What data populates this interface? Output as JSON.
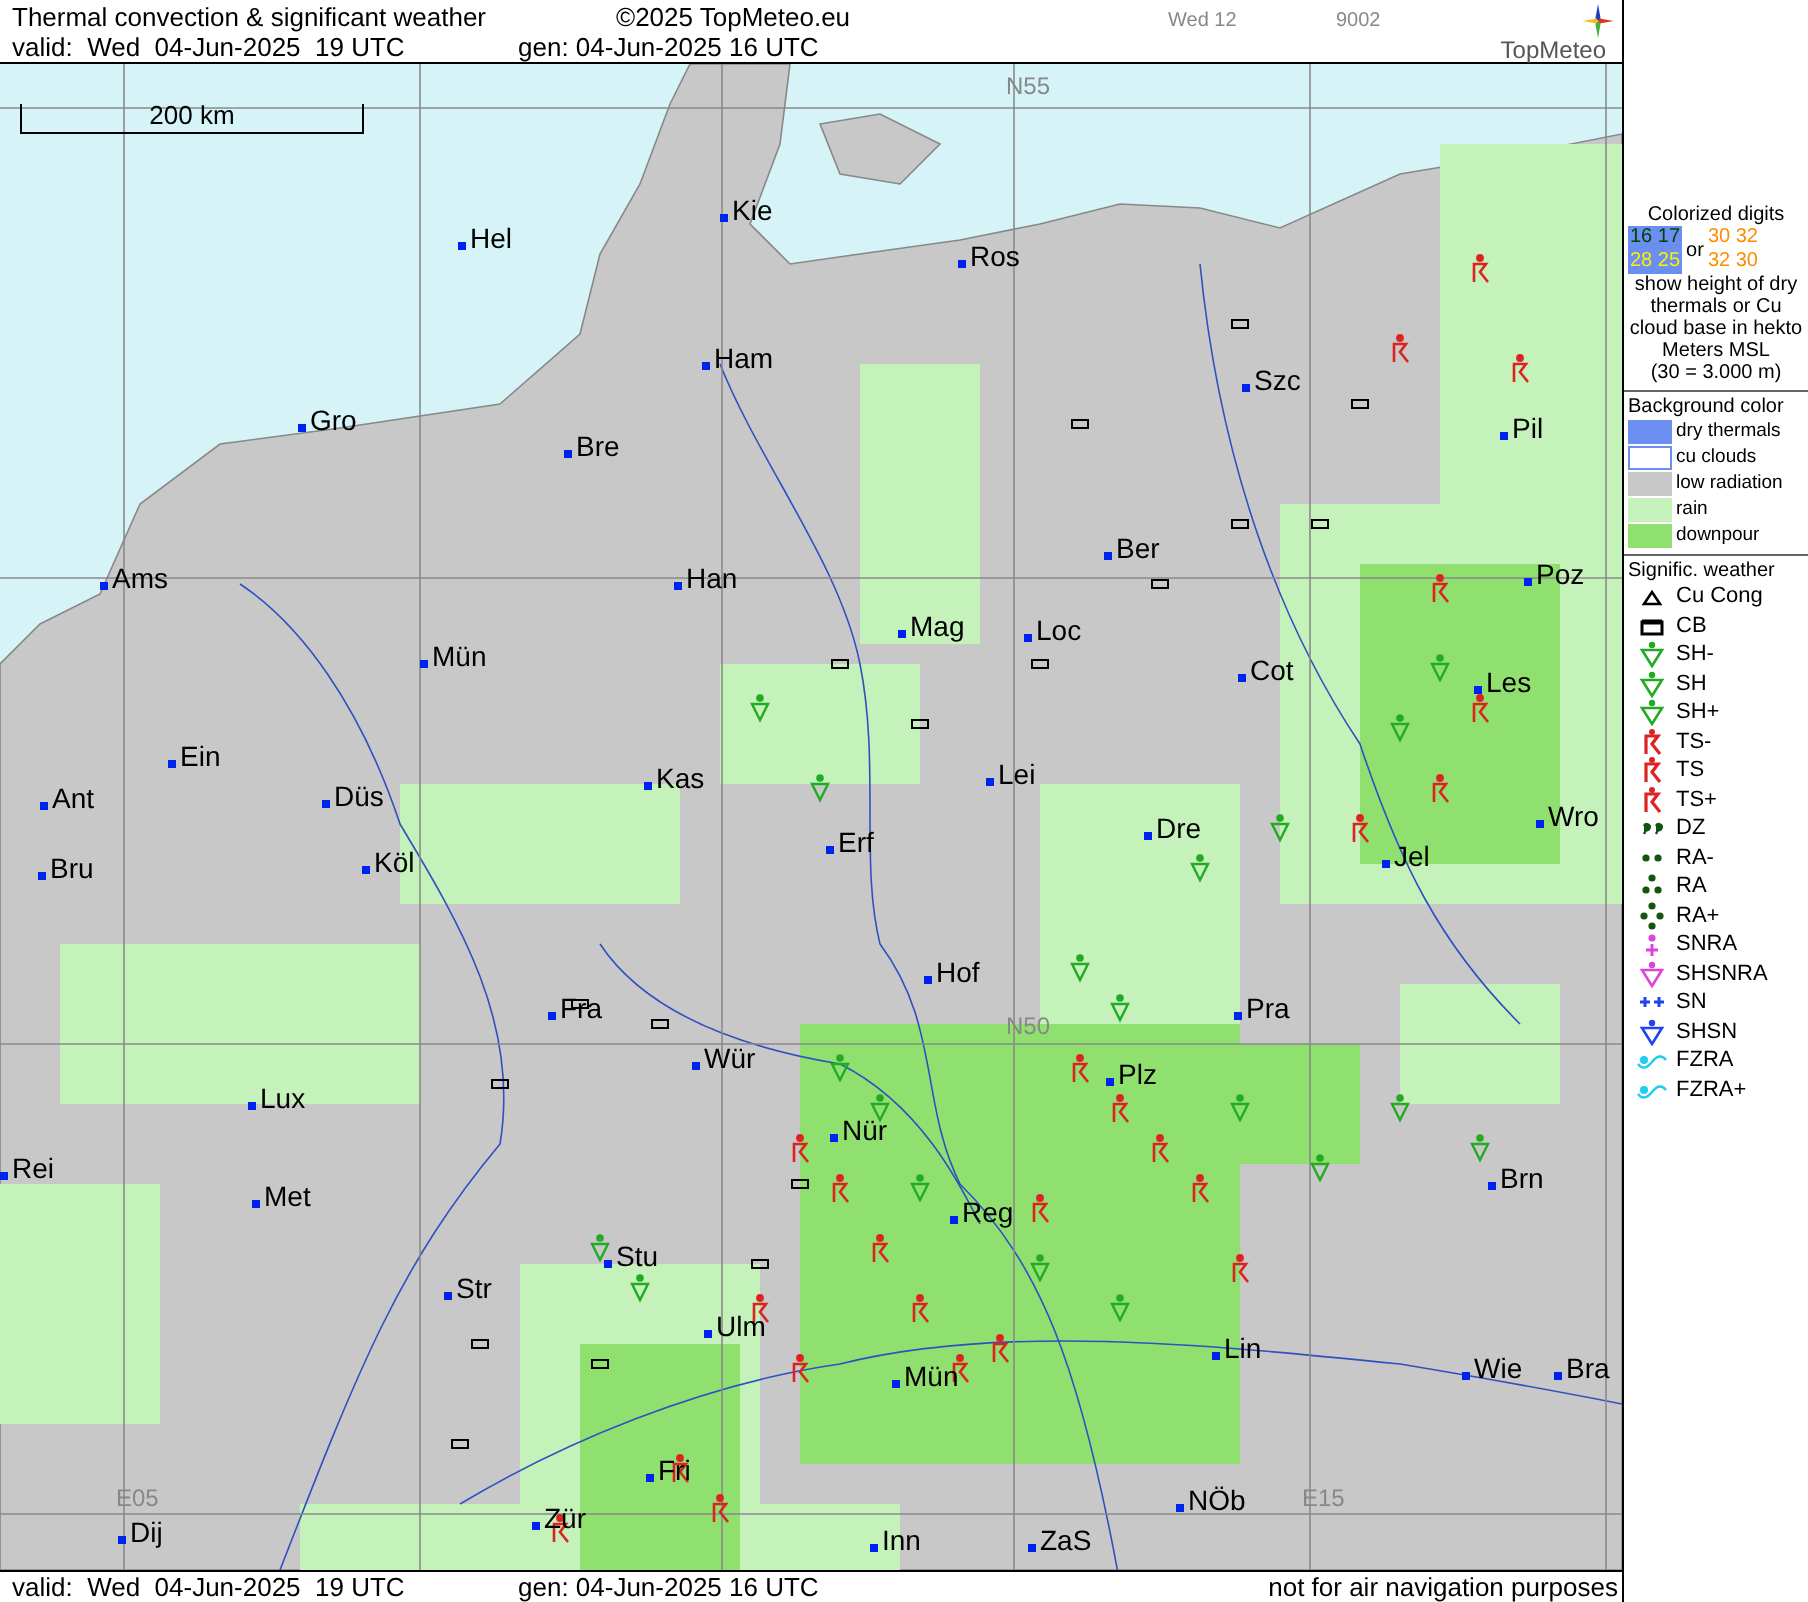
{
  "header": {
    "title": "Thermal convection & significant weather",
    "copyright": "©2025 TopMeteo.eu",
    "day": "Wed 12",
    "code": "9002",
    "logo": "TopMeteo",
    "valid": "valid:  Wed  04-Jun-2025  19 UTC",
    "gen": "gen: 04-Jun-2025 16 UTC"
  },
  "map": {
    "scale": "200 km",
    "grid_labels": [
      "N55",
      "N50",
      "E05",
      "E15"
    ],
    "cities": [
      "Hel",
      "Kie",
      "Ros",
      "Ham",
      "Gro",
      "Bre",
      "Szc",
      "Pil",
      "Ams",
      "Han",
      "Ber",
      "Poz",
      "Mag",
      "Loc",
      "Mün",
      "Cot",
      "Les",
      "Ein",
      "Kas",
      "Lei",
      "Ant",
      "Düs",
      "Dre",
      "Wro",
      "Bru",
      "Köl",
      "Erf",
      "Jel",
      "Hof",
      "Fra",
      "Pra",
      "Wür",
      "Plz",
      "Lux",
      "Nür",
      "Rei",
      "Met",
      "Brn",
      "Reg",
      "Stu",
      "Str",
      "Ulm",
      "Lin",
      "Mün",
      "Wie",
      "Bra",
      "Fri",
      "Dij",
      "Zür",
      "Inn",
      "ZaS",
      "NÖb"
    ]
  },
  "legend": {
    "digits_title": "Colorized digits",
    "dry_a": "16 17",
    "dry_b": "28 25",
    "or": "or",
    "cu_a": "30 32",
    "cu_b": "32 30",
    "digits_text": "show height of dry thermals or Cu cloud base in hekto Meters MSL",
    "digits_example": "(30 = 3.000 m)",
    "background_title": "Background color",
    "backgrounds": [
      {
        "label": "dry thermals",
        "color": "#6b8ff0"
      },
      {
        "label": "cu clouds",
        "color": "#ffffff"
      },
      {
        "label": "low radiation",
        "color": "#c8c8c8"
      },
      {
        "label": "rain",
        "color": "#c4f2ba"
      },
      {
        "label": "downpour",
        "color": "#90e070"
      }
    ],
    "weather_title": "Signific. weather",
    "weather": [
      {
        "label": "Cu Cong",
        "kind": "cucong",
        "color": "#000000"
      },
      {
        "label": "CB",
        "kind": "cb",
        "color": "#000000"
      },
      {
        "label": "SH-",
        "kind": "shower",
        "color": "#22aa22"
      },
      {
        "label": "SH",
        "kind": "shower",
        "color": "#22aa22"
      },
      {
        "label": "SH+",
        "kind": "shower",
        "color": "#22aa22"
      },
      {
        "label": "TS-",
        "kind": "storm",
        "color": "#dd2222"
      },
      {
        "label": "TS",
        "kind": "storm",
        "color": "#dd2222"
      },
      {
        "label": "TS+",
        "kind": "storm",
        "color": "#dd2222"
      },
      {
        "label": "DZ",
        "kind": "drizzle",
        "color": "#115511"
      },
      {
        "label": "RA-",
        "kind": "rain2",
        "color": "#115511"
      },
      {
        "label": "RA",
        "kind": "rain3",
        "color": "#115511"
      },
      {
        "label": "RA+",
        "kind": "rain4",
        "color": "#115511"
      },
      {
        "label": "SNRA",
        "kind": "snowrain",
        "color": "#dd44dd"
      },
      {
        "label": "SHSNRA",
        "kind": "shower",
        "color": "#dd44dd"
      },
      {
        "label": "SN",
        "kind": "snow",
        "color": "#2244ee"
      },
      {
        "label": "SHSN",
        "kind": "shower",
        "color": "#2244ee"
      },
      {
        "label": "FZRA",
        "kind": "freezing",
        "color": "#22ccee"
      },
      {
        "label": "FZRA+",
        "kind": "freezing",
        "color": "#22ccee"
      }
    ]
  },
  "footer": {
    "valid": "valid:  Wed  04-Jun-2025  19 UTC",
    "gen": "gen: 04-Jun-2025 16 UTC",
    "note": "not for air navigation purposes"
  }
}
